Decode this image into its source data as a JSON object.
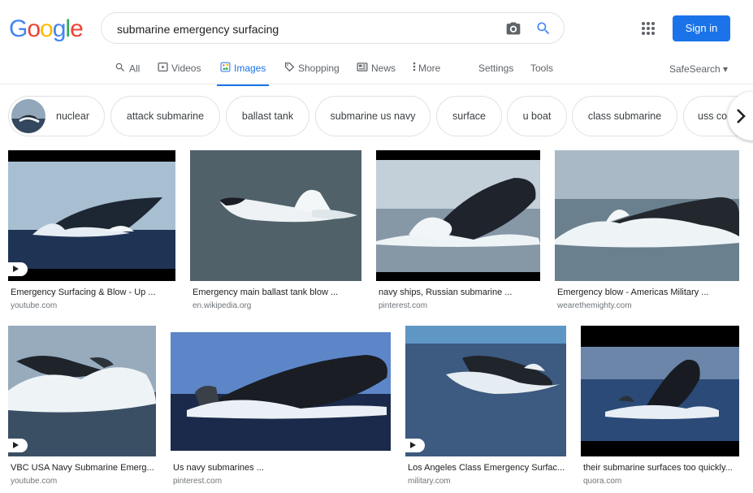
{
  "logo": {
    "letters": [
      "G",
      "o",
      "o",
      "g",
      "l",
      "e"
    ],
    "colors": [
      "#4285F4",
      "#EA4335",
      "#FBBC05",
      "#4285F4",
      "#34A853",
      "#EA4335"
    ]
  },
  "search": {
    "query": "submarine emergency surfacing"
  },
  "header": {
    "signin": "Sign in"
  },
  "tabs": [
    {
      "label": "All",
      "icon": "search-icon"
    },
    {
      "label": "Videos",
      "icon": "video-icon"
    },
    {
      "label": "Images",
      "icon": "image-icon",
      "active": true
    },
    {
      "label": "Shopping",
      "icon": "tag-icon"
    },
    {
      "label": "News",
      "icon": "news-icon"
    },
    {
      "label": "More",
      "icon": "more-vert-icon"
    },
    {
      "label": "Settings"
    },
    {
      "label": "Tools"
    }
  ],
  "safesearch": "SafeSearch ▾",
  "chips": [
    "nuclear",
    "attack submarine",
    "ballast tank",
    "submarine us navy",
    "surface",
    "u boat",
    "class submarine",
    "uss co"
  ],
  "results": [
    {
      "caption": "Emergency Surfacing & Blow - Up ...",
      "source": "youtube.com",
      "video": true
    },
    {
      "caption": "Emergency main ballast tank blow ...",
      "source": "en.wikipedia.org",
      "video": false
    },
    {
      "caption": "navy ships, Russian submarine ...",
      "source": "pinterest.com",
      "video": false
    },
    {
      "caption": "Emergency blow - Americas Military ...",
      "source": "wearethemighty.com",
      "video": false
    },
    {
      "caption": "VBC USA Navy Submarine Emerg...",
      "source": "youtube.com",
      "video": true
    },
    {
      "caption": "Us navy submarines ...",
      "source": "pinterest.com",
      "video": false
    },
    {
      "caption": "Los Angeles Class Emergency Surfac...",
      "source": "military.com",
      "video": true
    },
    {
      "caption": "their submarine surfaces too quickly...",
      "source": "quora.com",
      "video": false
    }
  ],
  "colors": {
    "accent": "#1a73e8",
    "sea": "#2a3d5c",
    "sky": "#b8c7d6",
    "foam": "#eef2f5",
    "hull": "#1c2028"
  }
}
